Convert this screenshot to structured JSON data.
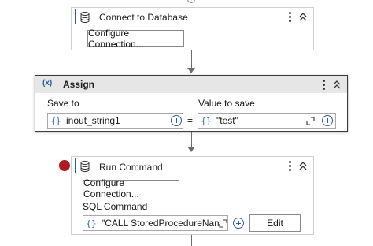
{
  "connect_db": {
    "title": "Connect to Database",
    "configure_label": "Configure Connection..."
  },
  "assign": {
    "icon_text": "(x)",
    "title": "Assign",
    "save_to_label": "Save to",
    "value_to_save_label": "Value to save",
    "save_to_value": "inout_string1",
    "equals": "=",
    "value_to_save_value": "\"test\"",
    "brace": "{}"
  },
  "run_command": {
    "title": "Run Command",
    "configure_label": "Configure Connection...",
    "sql_label": "SQL Command",
    "sql_value": "\"CALL StoredProcedureName",
    "edit_label": "Edit",
    "brace": "{}"
  },
  "colors": {
    "breakpoint": "#b3181f",
    "accent": "#2b5ea0",
    "header_selected": "#e6e6e6"
  }
}
